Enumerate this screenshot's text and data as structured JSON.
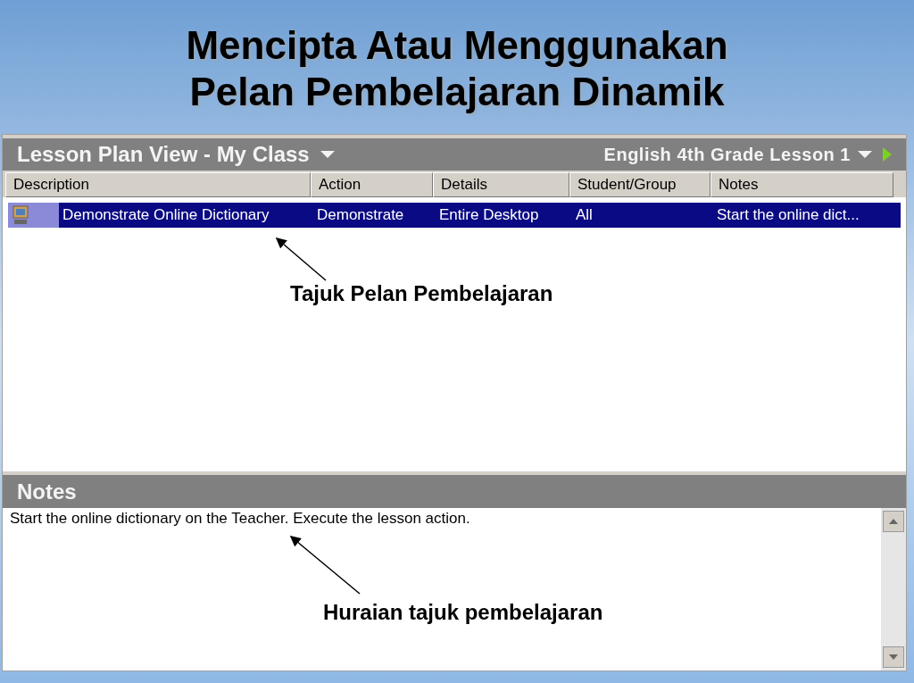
{
  "slide_title": [
    "Mencipta Atau Menggunakan",
    "Pelan Pembelajaran Dinamik"
  ],
  "header": {
    "title": "Lesson Plan View - My Class",
    "lesson": "English 4th Grade Lesson 1"
  },
  "table": {
    "columns": [
      "Description",
      "Action",
      "Details",
      "Student/Group",
      "Notes"
    ],
    "rows": [
      {
        "selected": true,
        "cells": [
          "Demonstrate Online Dictionary",
          "Demonstrate",
          "Entire Desktop",
          "All",
          "Start the online dict..."
        ]
      }
    ]
  },
  "notes": {
    "title": "Notes",
    "text": "Start the online dictionary on the Teacher. Execute the lesson action."
  },
  "annotations": [
    {
      "label": "Tajuk Pelan Pembelajaran"
    },
    {
      "label": "Huraian tajuk pembelajaran"
    }
  ]
}
